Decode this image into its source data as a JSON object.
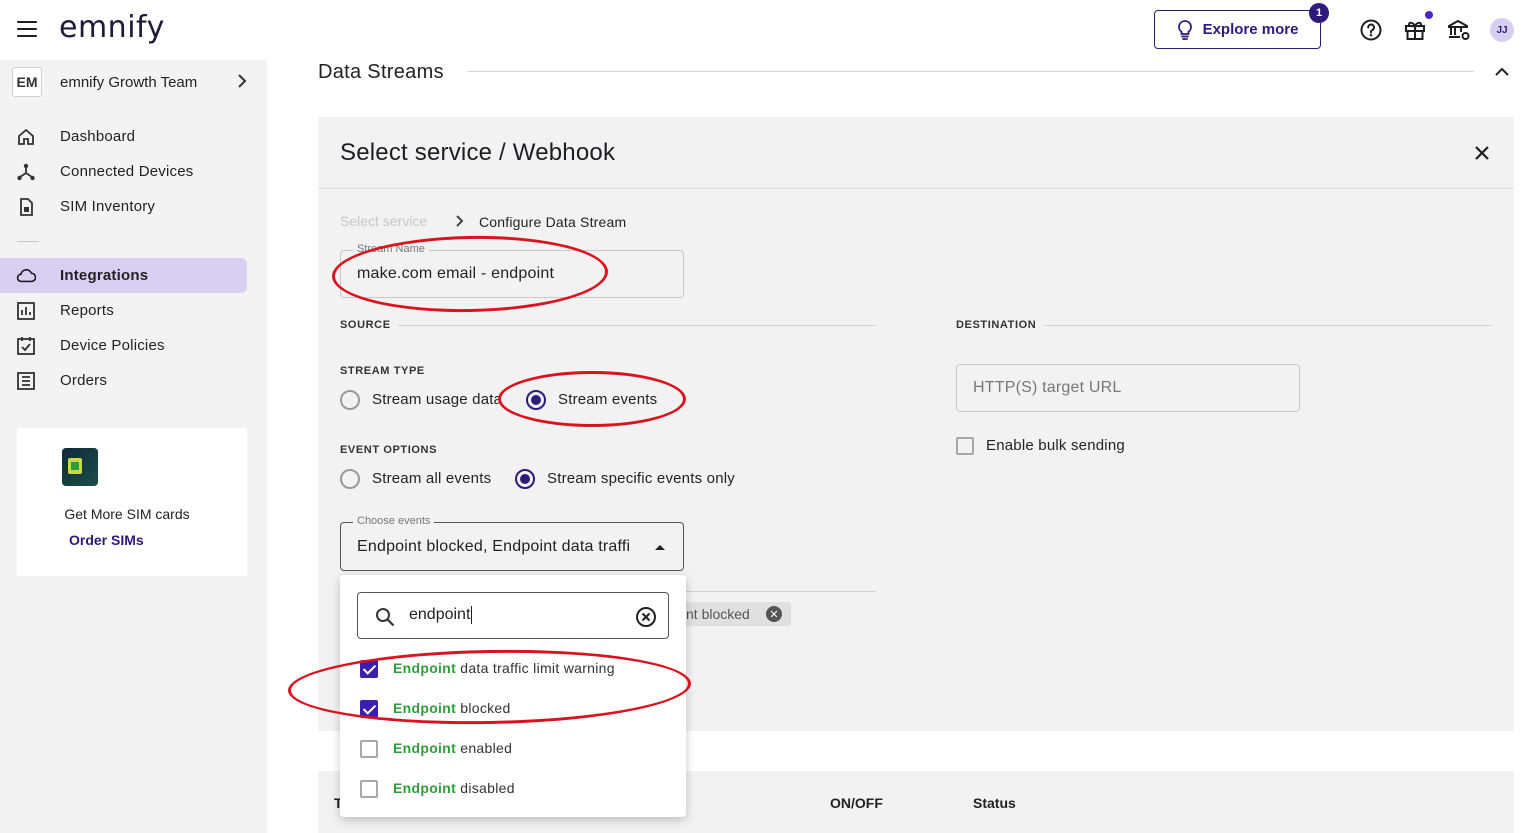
{
  "app": {
    "logo": "emnify"
  },
  "topbar": {
    "explore_label": "Explore more",
    "explore_badge": "1",
    "user_initials": "JJ"
  },
  "sidebar": {
    "org_initials": "EM",
    "org_name": "emnify Growth Team",
    "items": [
      {
        "label": "Dashboard",
        "icon": "home-icon"
      },
      {
        "label": "Connected Devices",
        "icon": "network-icon"
      },
      {
        "label": "SIM Inventory",
        "icon": "sim-icon"
      },
      {
        "label": "Integrations",
        "icon": "cloud-icon",
        "active": true
      },
      {
        "label": "Reports",
        "icon": "chart-icon"
      },
      {
        "label": "Device Policies",
        "icon": "policy-icon"
      },
      {
        "label": "Orders",
        "icon": "orders-icon"
      }
    ],
    "promo": {
      "text": "Get More SIM cards",
      "link": "Order SIMs"
    }
  },
  "main": {
    "section_title": "Data Streams",
    "panel_title": "Select service / Webhook",
    "breadcrumb": {
      "step1": "Select service",
      "step2": "Configure Data Stream"
    },
    "stream_name": {
      "label": "Stream Name",
      "value": "make.com email - endpoint"
    },
    "source": {
      "header": "SOURCE",
      "stream_type_header": "STREAM TYPE",
      "stream_type_options": [
        "Stream usage data",
        "Stream events"
      ],
      "stream_type_selected": "Stream events",
      "event_options_header": "EVENT OPTIONS",
      "event_options": [
        "Stream all events",
        "Stream specific events only"
      ],
      "event_options_selected": "Stream specific events only",
      "choose_events": {
        "label": "Choose events",
        "value": "Endpoint blocked, Endpoint data traffic limit warning"
      },
      "chip_text": "nt blocked"
    },
    "destination": {
      "header": "DESTINATION",
      "url_placeholder": "HTTP(S) target URL",
      "bulk_label": "Enable bulk sending"
    },
    "dropdown": {
      "search_value": "endpoint",
      "options": [
        {
          "highlight": "Endpoint",
          "rest": " data traffic limit warning",
          "checked": true
        },
        {
          "highlight": "Endpoint",
          "rest": " blocked",
          "checked": true
        },
        {
          "highlight": "Endpoint",
          "rest": " enabled",
          "checked": false
        },
        {
          "highlight": "Endpoint",
          "rest": " disabled",
          "checked": false
        }
      ]
    },
    "table_headers": [
      "T",
      "ON/OFF",
      "Status"
    ]
  },
  "colors": {
    "accent": "#2e1a7a",
    "highlight": "#2f9b3c",
    "annotation": "#d9141f"
  }
}
